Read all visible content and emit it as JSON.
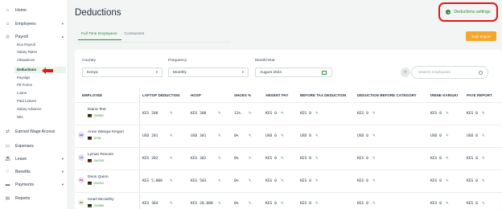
{
  "sidebar": {
    "items": [
      {
        "label": "Home",
        "icon": "home-icon"
      },
      {
        "label": "Employees",
        "icon": "people-icon"
      },
      {
        "label": "Payroll",
        "icon": "payroll-icon"
      },
      {
        "label": "Earned Wage Access",
        "icon": "wage-icon"
      },
      {
        "label": "Expenses",
        "icon": "expenses-icon"
      },
      {
        "label": "Leave",
        "icon": "leave-icon"
      },
      {
        "label": "Benefits",
        "icon": "heart-icon"
      },
      {
        "label": "Payments",
        "icon": "card-icon"
      },
      {
        "label": "Reports",
        "icon": "reports-icon"
      }
    ],
    "payroll_sub": [
      "Run Payroll",
      "Salary Rates",
      "Allowances",
      "Deductions",
      "Payslips",
      "P9 Forms",
      "Loans",
      "Paid Leaves",
      "Salary Advance",
      "Nits"
    ],
    "active_sub": "Deductions"
  },
  "header": {
    "title": "Deductions",
    "settings_label": "Deductions settings",
    "bulk_import": "Bulk Import"
  },
  "tabs": [
    "Full Time Employees",
    "Contractors"
  ],
  "filters": {
    "country_label": "Country",
    "country_value": "Kenya",
    "frequency_label": "Frequency",
    "frequency_value": "Monthly",
    "month_label": "Month/Year",
    "month_value": "August 2024",
    "search_placeholder": "Search employees"
  },
  "table": {
    "columns": [
      "EMPLOYEE",
      "LAPTOP DEDUCTION",
      "HOSP",
      "SHOES %",
      "ABSENT PAY",
      "BEFORE TAX DEDUCTION",
      "DEDUCTION BEFORE CATEGORY",
      "IRENE KARIUKI",
      "PAYE REPORT"
    ],
    "rows": [
      {
        "initials": "",
        "name": "Diana Test",
        "id": "JO#3831",
        "laptop": "KES 200",
        "hosp": "KES 300",
        "shoes": "12%",
        "absent": "KES 0",
        "before_tax": "KES 0",
        "before_cat": "KES 0",
        "irene": "KES 0",
        "paye": "KES 0"
      },
      {
        "initials": "AW",
        "name": "Anne Wangui Kingori",
        "id": "JO784",
        "laptop": "USD 201",
        "hosp": "USD 301",
        "shoes": "0%",
        "absent": "USD 0",
        "before_tax": "USD 0",
        "before_cat": "USD 0",
        "irene": "USD 0",
        "paye": "USD 0"
      },
      {
        "initials": "LR",
        "name": "Lyman Reeves",
        "id": "JO#7818",
        "laptop": "KES 202",
        "hosp": "KES 302",
        "shoes": "0%",
        "absent": "KES 0",
        "before_tax": "KES 0",
        "before_cat": "KES 0",
        "irene": "KES 0",
        "paye": "KES 0"
      },
      {
        "initials": "DQ",
        "name": "Deon Quinn",
        "id": "JO#7813",
        "laptop": "KES 5,000",
        "hosp": "KES 503",
        "shoes": "0%",
        "absent": "KES 0",
        "before_tax": "KES 0",
        "before_cat": "KES 0",
        "irene": "KES 0",
        "paye": "KES 0"
      },
      {
        "initials": "IM",
        "name": "Israel Mccarthy",
        "id": "JO#7898",
        "laptop": "KES 304",
        "hosp": "KES 20,000",
        "shoes": "0%",
        "absent": "KES 0",
        "before_tax": "KES 0",
        "before_cat": "KES 0",
        "irene": "KES 0",
        "paye": "KES 0"
      }
    ]
  },
  "colors": {
    "accent": "#2d8a3c",
    "highlight": "#e01818",
    "bulk": "#f4a72a"
  }
}
